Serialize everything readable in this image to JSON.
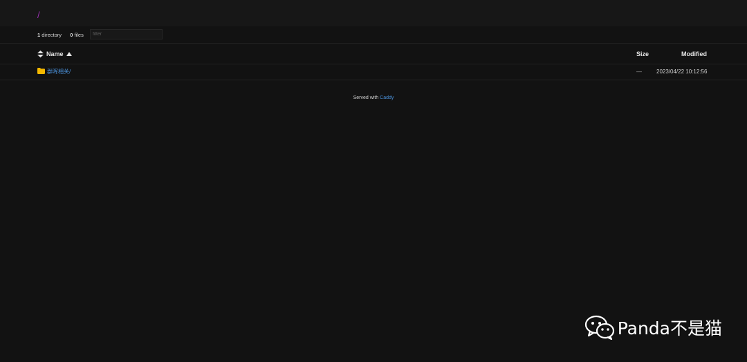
{
  "breadcrumb": "/",
  "summary": {
    "dir_count": "1",
    "dir_label": "directory",
    "file_count": "0",
    "file_label": "files"
  },
  "filter": {
    "placeholder": "filter",
    "value": ""
  },
  "table": {
    "columns": {
      "name": "Name",
      "size": "Size",
      "modified": "Modified"
    },
    "rows": [
      {
        "name": "群晖相关/",
        "size": "—",
        "modified": "2023/04/22 10:12:56",
        "icon": "folder-icon"
      }
    ]
  },
  "footer": {
    "prefix": "Served with",
    "link": "Caddy"
  },
  "watermark": {
    "text": "Panda不是猫",
    "icon": "wechat-icon"
  },
  "colors": {
    "background": "#121212",
    "header_background": "#171717",
    "link": "#4a90d9",
    "breadcrumb": "#9b2fb5",
    "folder": "#f5b800"
  }
}
